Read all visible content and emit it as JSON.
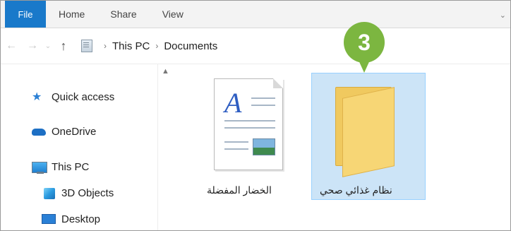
{
  "ribbon": {
    "tabs": [
      "File",
      "Home",
      "Share",
      "View"
    ]
  },
  "address": {
    "breadcrumbs": [
      "This PC",
      "Documents"
    ],
    "separator": "›"
  },
  "nav_pane": {
    "items": [
      {
        "label": "Quick access",
        "icon": "star-icon"
      },
      {
        "label": "OneDrive",
        "icon": "cloud-icon"
      },
      {
        "label": "This PC",
        "icon": "computer-icon"
      },
      {
        "label": "3D Objects",
        "icon": "cube-icon"
      },
      {
        "label": "Desktop",
        "icon": "desktop-icon"
      }
    ]
  },
  "content": {
    "items": [
      {
        "label": "الخضار المفضلة",
        "type": "document",
        "selected": false
      },
      {
        "label": "نظام غذائي صحي",
        "type": "folder",
        "selected": true
      }
    ]
  },
  "step_badge": "3",
  "colors": {
    "file_tab": "#1979ca",
    "selection": "#cce4f7",
    "badge": "#7cb640",
    "folder": "#f7d675"
  }
}
